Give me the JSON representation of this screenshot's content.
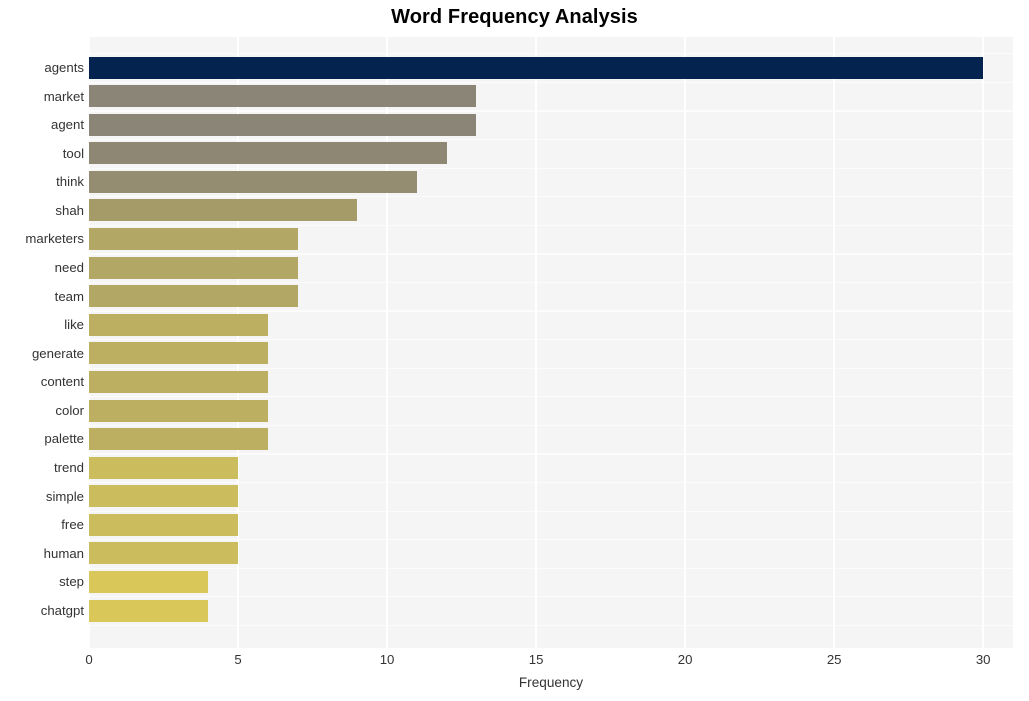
{
  "chart_data": {
    "type": "bar",
    "orientation": "horizontal",
    "title": "Word Frequency Analysis",
    "xlabel": "Frequency",
    "ylabel": "",
    "categories": [
      "agents",
      "market",
      "agent",
      "tool",
      "think",
      "shah",
      "marketers",
      "need",
      "team",
      "like",
      "generate",
      "content",
      "color",
      "palette",
      "trend",
      "simple",
      "free",
      "human",
      "step",
      "chatgpt"
    ],
    "values": [
      30,
      13,
      13,
      12,
      11,
      9,
      7,
      7,
      7,
      6,
      6,
      6,
      6,
      6,
      5,
      5,
      5,
      5,
      4,
      4
    ],
    "bar_colors": [
      "#04244f",
      "#8a8577",
      "#8a8577",
      "#8d8773",
      "#948d72",
      "#a59b68",
      "#b3a765",
      "#b3a765",
      "#b3a765",
      "#bcaf62",
      "#bcaf62",
      "#bcaf62",
      "#bcaf62",
      "#bcaf62",
      "#cbbc5e",
      "#cbbc5e",
      "#cbbc5e",
      "#cbbc5e",
      "#d9c75a",
      "#d9c75a"
    ],
    "xlim": [
      0,
      31.0
    ],
    "xticks": [
      0,
      5,
      10,
      15,
      20,
      25,
      30
    ],
    "xticklabels": [
      "0",
      "5",
      "10",
      "15",
      "20",
      "25",
      "30"
    ],
    "grid": true,
    "grid_color": "#ffffff",
    "plot_background": "#f5f5f5",
    "figure_background": "#ffffff",
    "legend": null,
    "title_color": "#000000",
    "tick_color": "#333333"
  }
}
